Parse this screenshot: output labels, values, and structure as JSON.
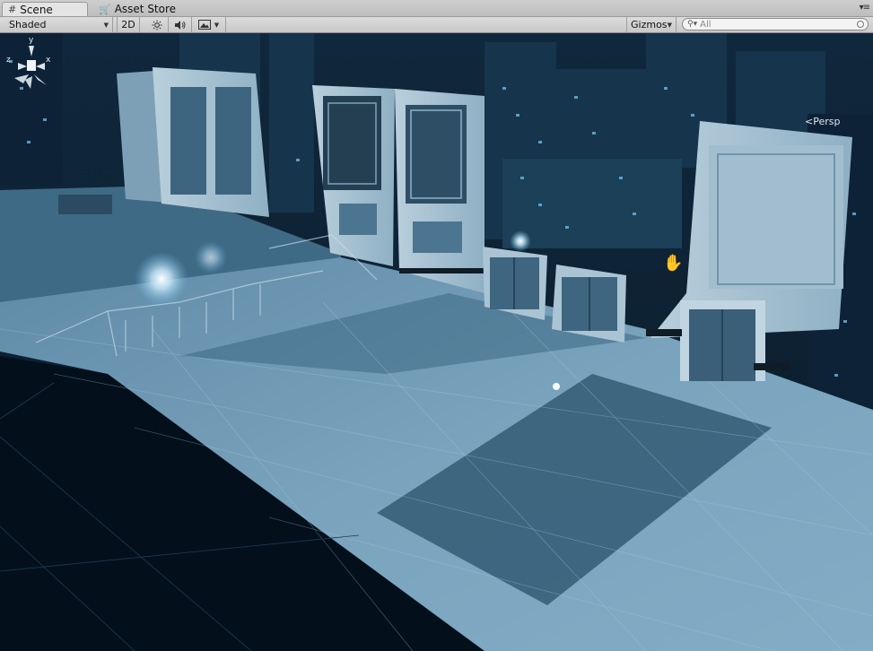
{
  "tabs": [
    {
      "label": "Scene",
      "icon": "grid-icon",
      "active": true
    },
    {
      "label": "Asset Store",
      "icon": "store-bag-icon",
      "active": false
    }
  ],
  "toolbar": {
    "render_mode": "Shaded",
    "toggle_2d": "2D",
    "lighting_icon": "sun-icon",
    "audio_icon": "speaker-icon",
    "effects_icon": "image-icon",
    "gizmos_label": "Gizmos",
    "search_placeholder": "All"
  },
  "viewport": {
    "projection_label": "Persp",
    "axes": {
      "y": "y",
      "x": "x",
      "z": "z"
    },
    "colors": {
      "sky": "#0c2438",
      "floor": "#6d97b2",
      "void": "#03101c",
      "accent_glow": "#d8f2ff"
    }
  }
}
